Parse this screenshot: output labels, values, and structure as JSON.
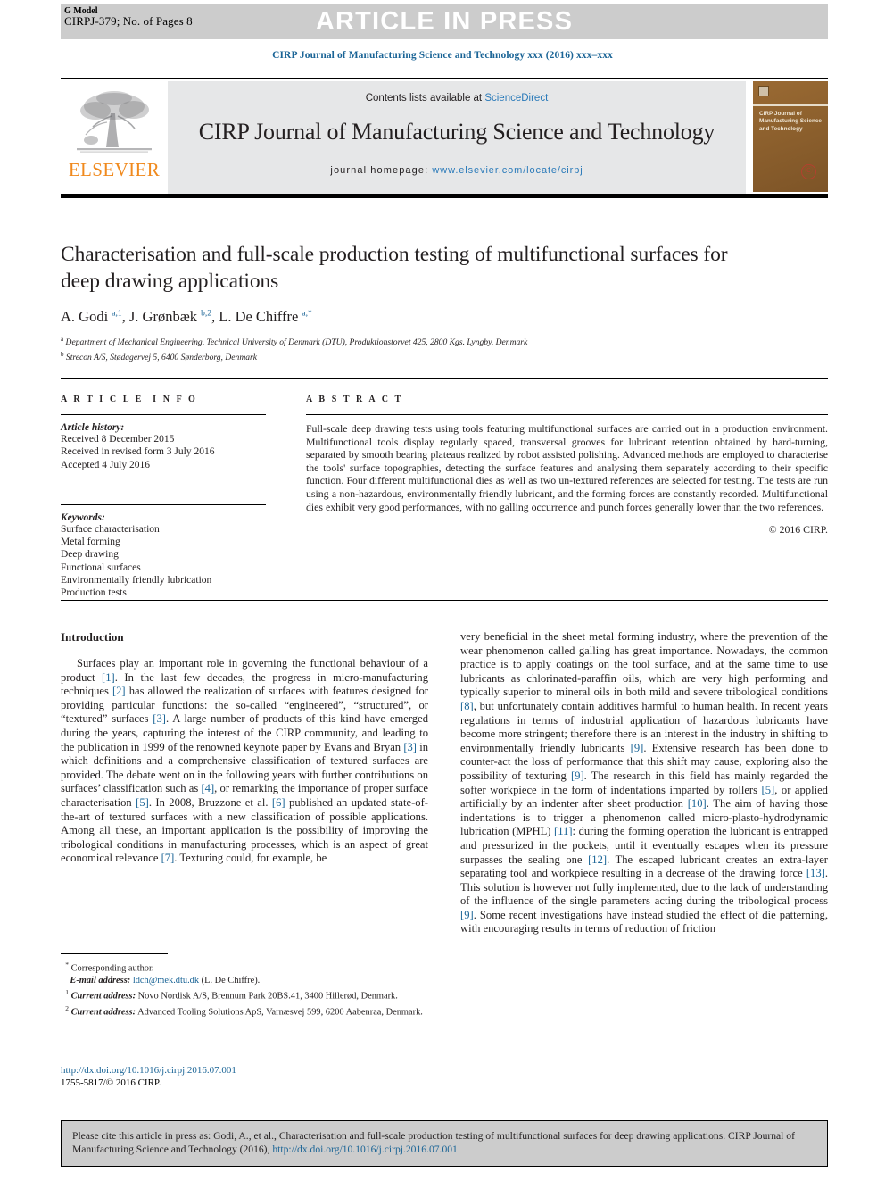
{
  "banner": {
    "text": "ARTICLE IN PRESS",
    "bg_color": "#cccccc",
    "text_color": "#ffffff"
  },
  "gmodel": {
    "line1": "G Model",
    "line2": "CIRPJ-379; No. of Pages 8"
  },
  "journal_line": "CIRP Journal of Manufacturing Science and Technology xxx (2016) xxx–xxx",
  "masthead": {
    "publisher": "ELSEVIER",
    "contents_prefix": "Contents lists available at ",
    "contents_link": "ScienceDirect",
    "journal_title": "CIRP Journal of Manufacturing Science and Technology",
    "homepage_prefix": "journal homepage: ",
    "homepage_link": "www.elsevier.com/locate/cirpj",
    "cover_title": "CIRP Journal of Manufacturing Science and Technology",
    "link_color": "#2a7ab9",
    "cover_color": "#8a5e2c"
  },
  "article": {
    "title": "Characterisation and full-scale production testing of multifunctional surfaces for deep drawing applications",
    "affiliations": [
      {
        "marker": "a",
        "text": "Department of Mechanical Engineering, Technical University of Denmark (DTU), Produktionstorvet 425, 2800 Kgs. Lyngby, Denmark"
      },
      {
        "marker": "b",
        "text": "Strecon A/S, Stødagervej 5, 6400 Sønderborg, Denmark"
      }
    ]
  },
  "info": {
    "heading": "ARTICLE INFO",
    "history_label": "Article history:",
    "history": [
      "Received 8 December 2015",
      "Received in revised form 3 July 2016",
      "Accepted 4 July 2016"
    ],
    "keywords_label": "Keywords:",
    "keywords": [
      "Surface characterisation",
      "Metal forming",
      "Deep drawing",
      "Functional surfaces",
      "Environmentally friendly lubrication",
      "Production tests"
    ]
  },
  "abstract": {
    "heading": "ABSTRACT",
    "text": "Full-scale deep drawing tests using tools featuring multifunctional surfaces are carried out in a production environment. Multifunctional tools display regularly spaced, transversal grooves for lubricant retention obtained by hard-turning, separated by smooth bearing plateaus realized by robot assisted polishing. Advanced methods are employed to characterise the tools' surface topographies, detecting the surface features and analysing them separately according to their specific function. Four different multifunctional dies as well as two un-textured references are selected for testing. The tests are run using a non-hazardous, environmentally friendly lubricant, and the forming forces are constantly recorded. Multifunctional dies exhibit very good performances, with no galling occurrence and punch forces generally lower than the two references.",
    "copyright": "© 2016 CIRP."
  },
  "body": {
    "intro_heading": "Introduction"
  },
  "footnotes": {
    "corresponding": "Corresponding author.",
    "email_label": "E-mail address:",
    "email": "ldch@mek.dtu.dk",
    "email_owner": "(L. De Chiffre).",
    "current_address_label": "Current address:",
    "note1": "Novo Nordisk A/S, Brennum Park 20BS.41, 3400 Hillerød, Denmark.",
    "note2": "Advanced Tooling Solutions ApS, Varnæsvej 599, 6200 Aabenraa, Denmark."
  },
  "doi": {
    "url": "http://dx.doi.org/10.1016/j.cirpj.2016.07.001",
    "issn_line": "1755-5817/© 2016 CIRP."
  },
  "cite_box": {
    "text_prefix": "Please cite this article in press as: Godi, A., et al., Characterisation and full-scale production testing of multifunctional surfaces for deep drawing applications. CIRP Journal of Manufacturing Science and Technology (2016), ",
    "link": "http://dx.doi.org/10.1016/j.cirpj.2016.07.001",
    "bg_color": "#cccccc"
  }
}
